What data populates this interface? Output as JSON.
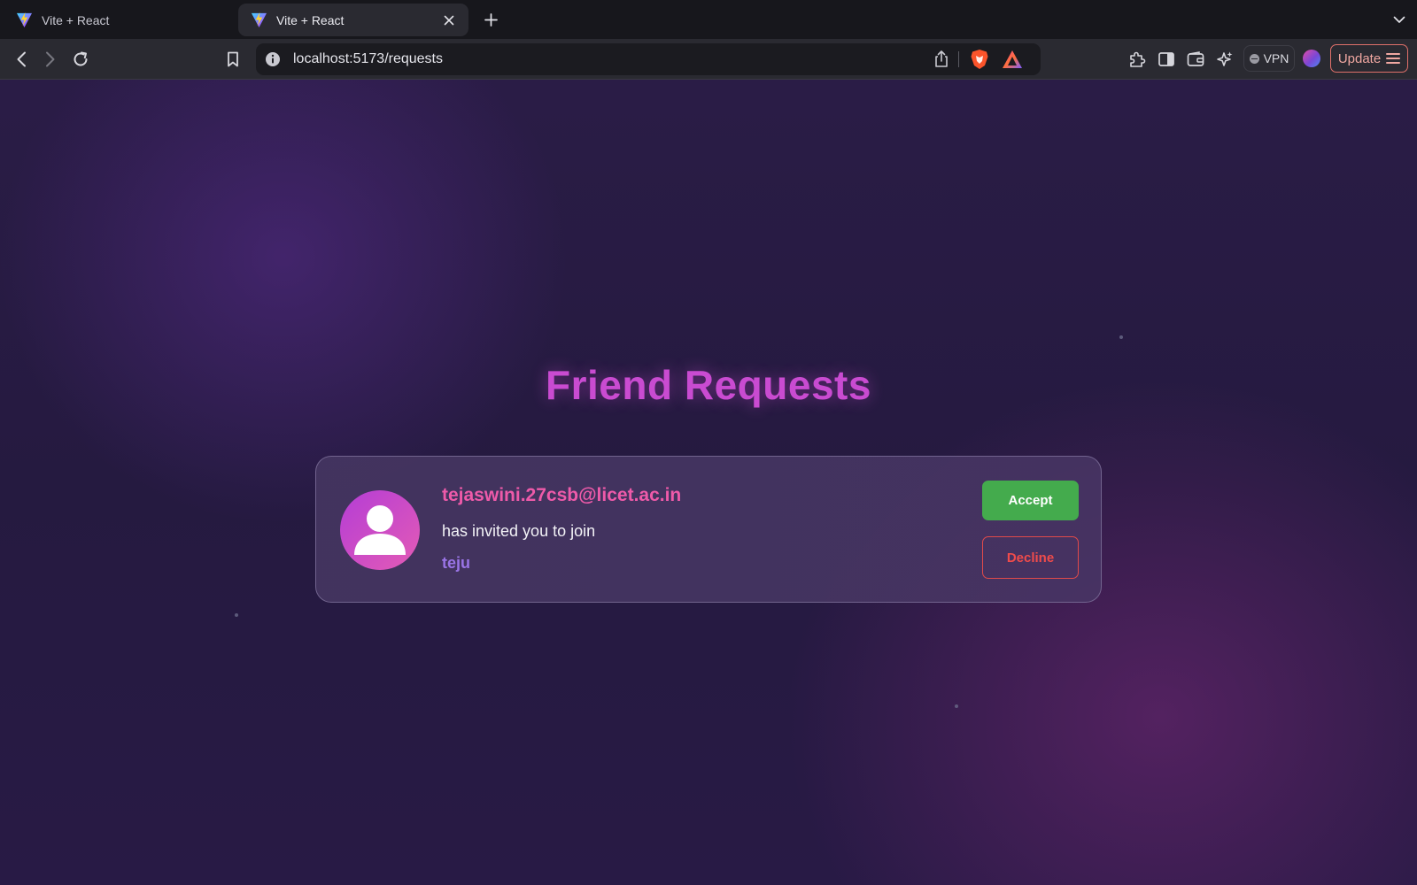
{
  "browser": {
    "tabs": [
      {
        "title": "Vite + React",
        "active": false
      },
      {
        "title": "Vite + React",
        "active": true
      }
    ],
    "url": "localhost:5173/requests",
    "vpn_label": "VPN",
    "update_label": "Update"
  },
  "page": {
    "title": "Friend Requests",
    "requests": [
      {
        "email": "tejaswini.27csb@licet.ac.in",
        "message": "has invited you to join",
        "group": "teju",
        "accept_label": "Accept",
        "decline_label": "Decline"
      }
    ]
  },
  "colors": {
    "title": "#c94bd1",
    "email": "#ee5aa9",
    "group": "#9a74e6",
    "accept": "#44ab4d",
    "decline": "#ef4b4b",
    "update_border": "#e0706a"
  },
  "icons": {
    "tab_favicon": "vite-icon",
    "back": "back-arrow-icon",
    "forward": "forward-arrow-icon",
    "reload": "reload-icon",
    "bookmark": "bookmark-icon",
    "info": "info-icon",
    "share": "share-icon",
    "shields": "brave-shields-icon",
    "rewards": "brave-rewards-icon",
    "extensions": "puzzle-icon",
    "sidebar": "sidebar-icon",
    "wallet": "wallet-icon",
    "leo": "leo-ai-icon",
    "profile": "profile-avatar-icon",
    "menu": "hamburger-menu-icon",
    "avatar": "user-avatar-icon"
  }
}
